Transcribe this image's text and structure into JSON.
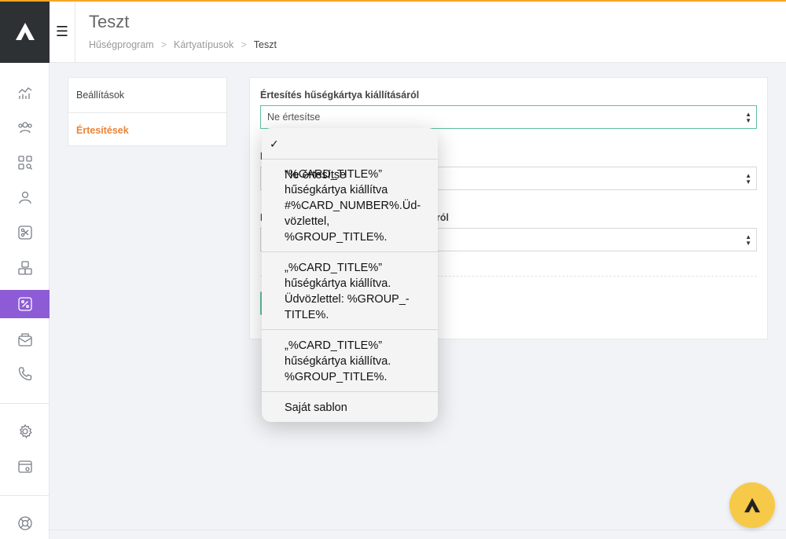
{
  "header": {
    "title": "Teszt",
    "menu_icon": "hamburger-icon",
    "breadcrumb": [
      "Hűségprogram",
      "Kártyatípusok",
      "Teszt"
    ],
    "breadcrumb_separator": ">"
  },
  "sidebar": {
    "logo": "brand-logo",
    "items": [
      {
        "icon": "analytics-icon"
      },
      {
        "icon": "users-icon"
      },
      {
        "icon": "grid-search-icon"
      },
      {
        "icon": "user-icon"
      },
      {
        "icon": "scissors-icon"
      },
      {
        "icon": "boxes-icon"
      },
      {
        "icon": "percent-icon",
        "active": true
      },
      {
        "icon": "mail-box-icon"
      },
      {
        "icon": "phone-icon"
      },
      {
        "icon": "gear-icon"
      },
      {
        "icon": "card-settings-icon"
      },
      {
        "icon": "lifebuoy-icon"
      }
    ],
    "active_color": "#8e5bd6"
  },
  "tabs": [
    {
      "label": "Beállítások",
      "active": false
    },
    {
      "label": "Értesítések",
      "active": true
    }
  ],
  "form": {
    "field1_label": "Értesítés hűségkártya kiállításáról",
    "field1_value": "Ne értesítse",
    "field2_label_prefix": "É",
    "field3_label_prefix": "É",
    "field3_label_suffix": "ról"
  },
  "dropdown": {
    "options": [
      {
        "label": "Ne értesítse",
        "selected": true
      },
      {
        "label": "“%CARD_TITLE%”\nhűségkártya kiállítva\n#%CARD_NUMBER%.Üd-\nvözlettel,\n%GROUP_TITLE%.",
        "selected": false
      },
      {
        "label": "„%CARD_TITLE%”\nhűségkártya kiállítva.\nÜdvözlettel: %GROUP_-\nTITLE%.",
        "selected": false
      },
      {
        "label": "„%CARD_TITLE%”\nhűségkártya kiállítva.\n%GROUP_TITLE%.",
        "selected": false
      },
      {
        "label": "Saját sablon",
        "selected": false
      }
    ],
    "check_mark": "✓"
  },
  "colors": {
    "accent_orange": "#e8853b",
    "accent_green": "#5fbfa0",
    "fab_yellow": "#f7c948",
    "dark": "#2e3134"
  },
  "fab": {
    "icon": "brand-logo-icon"
  }
}
